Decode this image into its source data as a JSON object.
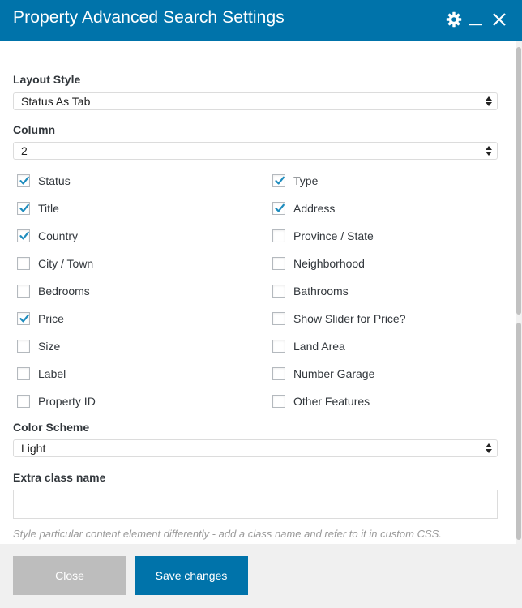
{
  "dialog": {
    "title": "Property Advanced Search Settings",
    "colors": {
      "header": "#0073aa",
      "checkmark": "#1e8cbe",
      "primary_button": "#0073aa",
      "secondary_button": "#bdbdbd"
    }
  },
  "icons": [
    "gear-icon",
    "minimize-icon",
    "close-icon",
    "checkmark-icon",
    "select-arrows-icon"
  ],
  "fields": {
    "layout_style": {
      "label": "Layout Style",
      "value": "Status As Tab"
    },
    "column": {
      "label": "Column",
      "value": "2"
    },
    "color_scheme": {
      "label": "Color Scheme",
      "value": "Light"
    },
    "extra_class": {
      "label": "Extra class name",
      "value": "",
      "help": "Style particular content element differently - add a class name and refer to it in custom CSS."
    }
  },
  "checkboxes": {
    "left": [
      {
        "label": "Status",
        "checked": true
      },
      {
        "label": "Title",
        "checked": true
      },
      {
        "label": "Country",
        "checked": true
      },
      {
        "label": "City / Town",
        "checked": false
      },
      {
        "label": "Bedrooms",
        "checked": false
      },
      {
        "label": "Price",
        "checked": true
      },
      {
        "label": "Size",
        "checked": false
      },
      {
        "label": "Label",
        "checked": false
      },
      {
        "label": "Property ID",
        "checked": false
      }
    ],
    "right": [
      {
        "label": "Type",
        "checked": true
      },
      {
        "label": "Address",
        "checked": true
      },
      {
        "label": "Province / State",
        "checked": false
      },
      {
        "label": "Neighborhood",
        "checked": false
      },
      {
        "label": "Bathrooms",
        "checked": false
      },
      {
        "label": "Show Slider for Price?",
        "checked": false
      },
      {
        "label": "Land Area",
        "checked": false
      },
      {
        "label": "Number Garage",
        "checked": false
      },
      {
        "label": "Other Features",
        "checked": false
      }
    ]
  },
  "footer": {
    "close_label": "Close",
    "save_label": "Save changes"
  }
}
